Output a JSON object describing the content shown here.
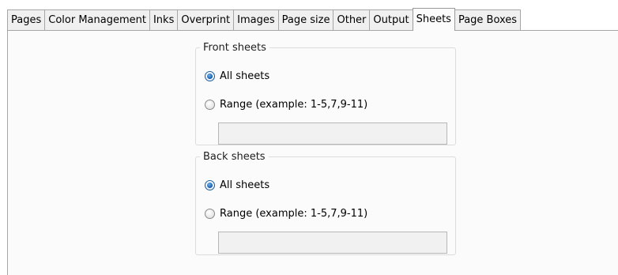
{
  "tabs": [
    {
      "label": "Pages"
    },
    {
      "label": "Color Management"
    },
    {
      "label": "Inks"
    },
    {
      "label": "Overprint"
    },
    {
      "label": "Images"
    },
    {
      "label": "Page size"
    },
    {
      "label": "Other"
    },
    {
      "label": "Output"
    },
    {
      "label": "Sheets",
      "active": true
    },
    {
      "label": "Page Boxes"
    }
  ],
  "front": {
    "title": "Front sheets",
    "all_label": "All sheets",
    "all_selected": true,
    "range_label": "Range (example: 1-5,7,9-11)",
    "range_selected": false,
    "range_value": ""
  },
  "back": {
    "title": "Back sheets",
    "all_label": "All sheets",
    "all_selected": true,
    "range_label": "Range (example: 1-5,7,9-11)",
    "range_selected": false,
    "range_value": ""
  }
}
